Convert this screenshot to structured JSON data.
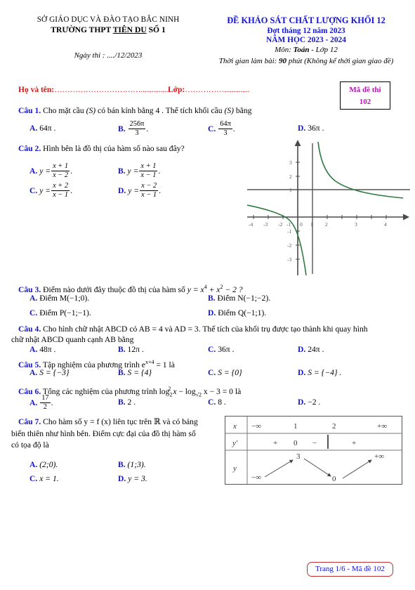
{
  "header": {
    "department": "SỞ GIÁO DỤC VÀ ĐÀO TẠO BẮC NINH",
    "school_prefix": "TRƯỜNG THPT ",
    "school_underlined": "TIÊN DU",
    "school_suffix": " SỐ 1",
    "exam_date": "Ngày thi : ..../12/2023",
    "exam_title": "ĐỀ KHẢO SÁT CHẤT LƯỢNG KHỐI 12",
    "exam_session": "Đợt tháng 12 năm 2023",
    "school_year": "NĂM HỌC 2023 - 2024",
    "subject_prefix": "Môn: ",
    "subject_bold": "Toán",
    "subject_suffix": " - Lớp 12",
    "time_prefix": "Thời gian làm bài: ",
    "time_bold": "90",
    "time_suffix": " phút (Không kể thời gian giao đề)",
    "code_label": "Mã đề thi",
    "code_value": "102",
    "name_label": "Họ và tên:",
    "name_dots": "……………………………...............",
    "class_label": "Lớp:",
    "class_dots": "…………….............."
  },
  "questions": [
    {
      "num": "Câu 1.",
      "text_parts": [
        "Cho mặt cầu ",
        "(S)",
        " có bán kính bằng ",
        "4",
        ". Thể tích khối cầu ",
        "(S)",
        " bằng"
      ],
      "options": [
        {
          "label": "A.",
          "value": "64π ."
        },
        {
          "label": "B.",
          "num": "256π",
          "den": "3",
          "suffix": "."
        },
        {
          "label": "C.",
          "num": "64π",
          "den": "3",
          "suffix": "."
        },
        {
          "label": "D.",
          "value": "36π ."
        }
      ]
    },
    {
      "num": "Câu 2.",
      "text": "Hình bên là đồ thị của hàm số nào sau đây?",
      "options": [
        {
          "label": "A.",
          "lhs": "y =",
          "num": "x + 1",
          "den": "x − 2",
          "suffix": "."
        },
        {
          "label": "B.",
          "lhs": "y =",
          "num": "x + 1",
          "den": "x − 1",
          "suffix": "."
        },
        {
          "label": "C.",
          "lhs": "y =",
          "num": "x + 2",
          "den": "x − 1",
          "suffix": "."
        },
        {
          "label": "D.",
          "lhs": "y =",
          "num": "x − 2",
          "den": "x − 1",
          "suffix": "."
        }
      ]
    },
    {
      "num": "Câu 3.",
      "text": "Điểm nào dưới đây thuộc đồ thị của hàm số",
      "formula": "y = x⁴ + x² − 2 ?",
      "options": [
        {
          "label": "A.",
          "value": "Điểm M(−1;0)."
        },
        {
          "label": "B.",
          "value": "Điểm N(−1;−2)."
        },
        {
          "label": "C.",
          "value": "Điểm P(−1;−1)."
        },
        {
          "label": "D.",
          "value": "Điểm Q(−1;1)."
        }
      ]
    },
    {
      "num": "Câu 4.",
      "text_line1": "Cho hình chữ nhật ABCD có AB = 4 và AD = 3. Thể tích của khối trụ được tạo thành khi quay hình",
      "text_line2": "chữ nhật ABCD quanh cạnh AB bằng",
      "options": [
        {
          "label": "A.",
          "value": "48π ."
        },
        {
          "label": "B.",
          "value": "12π ."
        },
        {
          "label": "C.",
          "value": "36π ."
        },
        {
          "label": "D.",
          "value": "24π ."
        }
      ]
    },
    {
      "num": "Câu 5.",
      "text": "Tập nghiệm của phương trình e",
      "exponent": "x+4",
      "text_after": " = 1 là",
      "options": [
        {
          "label": "A.",
          "value": "S = {−3}"
        },
        {
          "label": "B.",
          "value": "S = {4}"
        },
        {
          "label": "C.",
          "value": "S = {0}"
        },
        {
          "label": "D.",
          "value": "S = {−4} ."
        }
      ]
    },
    {
      "num": "Câu 6.",
      "text": "Tổng các nghiệm của phương trình log",
      "text_after": " x − 3 = 0 là",
      "options": [
        {
          "label": "A.",
          "num": "17",
          "den": "2",
          "suffix": "."
        },
        {
          "label": "B.",
          "value": "2 ."
        },
        {
          "label": "C.",
          "value": "8 ."
        },
        {
          "label": "D.",
          "value": "−2 ."
        }
      ]
    },
    {
      "num": "Câu 7.",
      "text_line1": "Cho hàm số y = f (x) liên tục trên ℝ và có bảng",
      "text_line2": "biến thiên như hình bên. Điểm cực đại của đồ thị hàm số",
      "text_line3": "có tọa độ là",
      "options": [
        {
          "label": "A.",
          "value": "(2;0)."
        },
        {
          "label": "B.",
          "value": "(1;3)."
        },
        {
          "label": "C.",
          "value": "x = 1."
        },
        {
          "label": "D.",
          "value": "y = 3."
        }
      ]
    }
  ],
  "graph": {
    "description": "Đồ thị hàm số hyperbol",
    "x_ticks": [
      "-4",
      "-3",
      "-2",
      "-1",
      "0",
      "1",
      "2",
      "3",
      "4"
    ],
    "y_ticks": [
      "3",
      "2",
      "1",
      "-1",
      "-2",
      "-3"
    ],
    "vertical_asymptote": "x = 1",
    "horizontal_asymptote": "y = 1",
    "curve_color": "#2f7a3f",
    "axis_color": "#555555"
  },
  "variation_table": {
    "row_labels": [
      "x",
      "y'",
      "y"
    ],
    "x_values": [
      "−∞",
      "1",
      "2",
      "+∞"
    ],
    "yprime_signs": [
      "+",
      "0",
      "−",
      "+"
    ],
    "y_values": [
      "−∞",
      "3",
      "0",
      "+∞"
    ]
  },
  "footer": {
    "text": "Trang 1/6 - Mã đề 102"
  }
}
